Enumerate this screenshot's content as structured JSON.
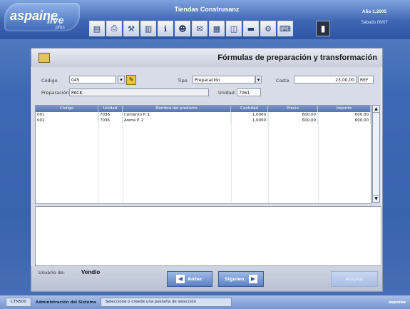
{
  "header": {
    "logo_text": "aspaine",
    "logo_text_2": "live",
    "logo_sub": "plus",
    "app_title": "Tiendas Construsanz",
    "date": "Año 1,2005",
    "time": "Sábado 06/07",
    "toolbar_icons": [
      "document-icon",
      "print-icon",
      "tools-icon",
      "chart-icon",
      "info-icon",
      "people-icon",
      "mail-icon",
      "calendar-icon",
      "scan-icon",
      "folder-icon",
      "settings-icon",
      "keyboard-icon"
    ],
    "exit_icon": "door-icon"
  },
  "window": {
    "title": "Fórmulas de preparación y transformación",
    "fields": {
      "codigo_label": "Código",
      "codigo_value": "045",
      "tipo_label": "Tipo",
      "tipo_value": "Preparación",
      "coste_label": "Coste",
      "coste_value": "23,00,00",
      "coste_unit": "REF",
      "preparacion_label": "Preparación",
      "preparacion_value": "PACK",
      "unidad_label": "Unidad",
      "unidad_value": "7061"
    },
    "table": {
      "columns": [
        "Código",
        "Unidad",
        "Nombre del producto",
        "Cantidad",
        "Precio",
        "Importe"
      ],
      "rows": [
        [
          "001",
          "7036",
          "Cemento P. 1",
          "1,0000",
          "600,00",
          "600,00"
        ],
        [
          "002",
          "7036",
          "Arena P. 2",
          "1,0000",
          "600,00",
          "600,00"
        ]
      ]
    },
    "footer": {
      "user_label": "Usuario de:",
      "user_name": "Vendio",
      "prev_label": "Anter.",
      "next_label": "Siguien.",
      "accept_label": "Aceptar"
    }
  },
  "statusbar": {
    "code": "CTN500",
    "module": "Administración del Sistema",
    "message": "Seleccione o creede una pestaña de selección"
  },
  "status_brand": "aspaine"
}
